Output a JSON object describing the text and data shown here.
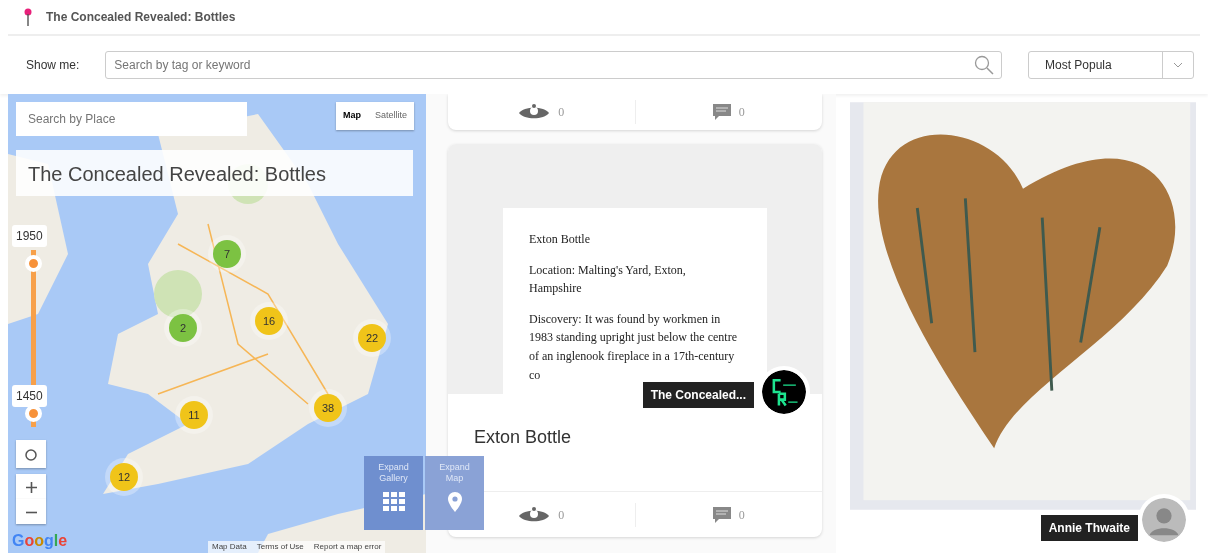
{
  "header": {
    "title": "The Concealed Revealed: Bottles"
  },
  "filter": {
    "label": "Show me:",
    "search": {
      "placeholder": "Search by tag or keyword"
    },
    "sort": {
      "value": "Most Popula"
    }
  },
  "map": {
    "place_search": {
      "placeholder": "Search by Place"
    },
    "map_types": [
      {
        "label": "Map",
        "selected": true
      },
      {
        "label": "Satellite",
        "selected": false
      }
    ],
    "title": "The Concealed Revealed: Bottles",
    "time_handles": [
      {
        "label": "1950",
        "level": 0.97
      },
      {
        "label": "1450",
        "level": 0.03
      }
    ],
    "clusters": [
      {
        "count": "7",
        "color": "#7cc242"
      },
      {
        "count": "2",
        "color": "#7cc242"
      },
      {
        "count": "16",
        "color": "#f0c419"
      },
      {
        "count": "22",
        "color": "#f0c419"
      },
      {
        "count": "11",
        "color": "#f0c419"
      },
      {
        "count": "38",
        "color": "#f0c419"
      },
      {
        "count": "12",
        "color": "#f0c419"
      }
    ],
    "logo": "Google",
    "attribution": [
      "Map Data",
      "Terms of Use",
      "Report a map error"
    ],
    "expand_buttons": [
      {
        "kind": "gallery",
        "label": "Expand Gallery"
      },
      {
        "kind": "map",
        "label": "Expand Map"
      }
    ]
  },
  "cards": [
    {
      "kind": "partial",
      "views": "0",
      "comments": "0"
    },
    {
      "kind": "document",
      "document": [
        "Exton Bottle",
        "Location: Malting's Yard, Exton, Hampshire",
        "Discovery: It was found by workmen in 1983 standing upright just below the centre of an inglenook fireplace in a 17th-century co"
      ],
      "author": "The Concealed...",
      "title": "Exton Bottle",
      "views": "0",
      "comments": "0"
    }
  ],
  "photo_card": {
    "author": "Annie Thwaite"
  }
}
